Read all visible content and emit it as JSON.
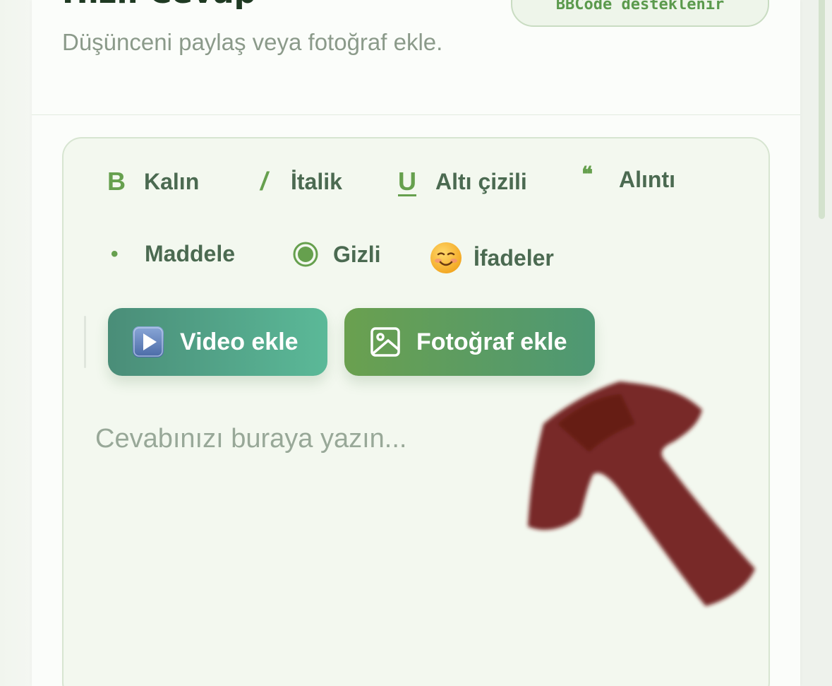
{
  "header": {
    "title": "Hızlı Cevap",
    "badge": "BBCode desteklenir",
    "subtitle": "Düşünceni paylaş veya fotoğraf ekle."
  },
  "toolbar": {
    "bold": {
      "icon": "B",
      "label": "Kalın"
    },
    "italic": {
      "icon": "/",
      "label": "İtalik"
    },
    "underline": {
      "icon": "U",
      "label": "Altı çizili"
    },
    "quote": {
      "icon": "❝",
      "label": "Alıntı"
    },
    "list": {
      "icon": "•",
      "label": "Maddele"
    },
    "hidden": {
      "label": "Gizli"
    },
    "emoji": {
      "icon": "☺️",
      "label": "İfadeler"
    }
  },
  "media": {
    "video_label": "Video ekle",
    "photo_label": "Fotoğraf ekle"
  },
  "reply": {
    "placeholder": "Cevabınızı buraya yazın...",
    "value": ""
  },
  "colors": {
    "accent": "#66a04e",
    "annotation_arrow": "#6e1a14"
  }
}
